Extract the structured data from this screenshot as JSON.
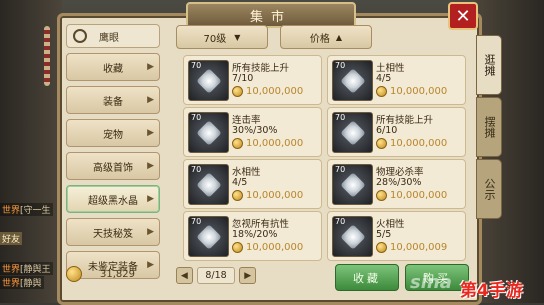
{
  "header": {
    "title": "集市"
  },
  "right_tabs": [
    "逛摊",
    "摆摊",
    "公示"
  ],
  "search": {
    "label": "鹰眼"
  },
  "categories": [
    {
      "label": "收藏"
    },
    {
      "label": "装备"
    },
    {
      "label": "宠物"
    },
    {
      "label": "高级首饰"
    },
    {
      "label": "超级黑水晶"
    },
    {
      "label": "天技秘笈"
    },
    {
      "label": "未鉴定装备"
    }
  ],
  "filters": {
    "level": "70级",
    "price": "价格"
  },
  "items": [
    {
      "level": "70",
      "name": "所有技能上升",
      "value": "7/10",
      "price": "10,000,000"
    },
    {
      "level": "70",
      "name": "土相性",
      "value": "4/5",
      "price": "10,000,000"
    },
    {
      "level": "70",
      "name": "连击率",
      "value": "30%/30%",
      "price": "10,000,000"
    },
    {
      "level": "70",
      "name": "所有技能上升",
      "value": "6/10",
      "price": "10,000,000"
    },
    {
      "level": "70",
      "name": "水相性",
      "value": "4/5",
      "price": "10,000,000"
    },
    {
      "level": "70",
      "name": "物理必杀率",
      "value": "28%/30%",
      "price": "10,000,000"
    },
    {
      "level": "70",
      "name": "忽视所有抗性",
      "value": "18%/20%",
      "price": "10,000,000"
    },
    {
      "level": "70",
      "name": "火相性",
      "value": "5/5",
      "price": "10,000,009"
    }
  ],
  "money": "31,829",
  "pager": {
    "prev": "◀",
    "page": "8/18",
    "next": "▶"
  },
  "buttons": {
    "favorite": "收藏",
    "buy": "购买"
  },
  "chat": [
    {
      "tag": "世界",
      "text": "[守一生"
    },
    {
      "tag": "世界",
      "text": "[静舆王"
    },
    {
      "tag": "世界",
      "text": "[静舆"
    }
  ],
  "friends_label": "好友",
  "watermark": {
    "site": "sina",
    "brand": "第4手游"
  },
  "colors": {
    "accent_green": "#4fa34d",
    "close_red": "#b32020",
    "gold": "#b8862a"
  }
}
